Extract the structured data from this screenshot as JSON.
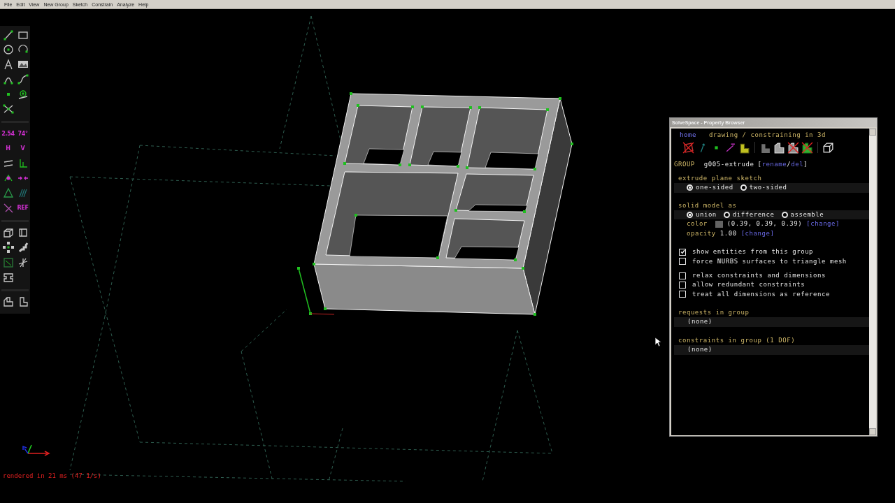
{
  "menu": [
    "File",
    "Edit",
    "View",
    "New Group",
    "Sketch",
    "Constrain",
    "Analyze",
    "Help"
  ],
  "toolbar": [
    [
      {
        "kind": "line"
      },
      {
        "kind": "rectangle"
      },
      {
        "kind": "circle"
      },
      {
        "kind": "arc"
      },
      {
        "kind": "text"
      },
      {
        "kind": "image"
      },
      {
        "kind": "tangent-arc"
      },
      {
        "kind": "spline"
      },
      {
        "kind": "point"
      },
      {
        "kind": "workplane"
      },
      {
        "kind": "split"
      }
    ],
    [
      {
        "kind": "distance",
        "label": "2.54"
      },
      {
        "kind": "angle",
        "label": "74°"
      },
      {
        "kind": "horizontal",
        "label": "H"
      },
      {
        "kind": "vertical",
        "label": "V"
      },
      {
        "kind": "parallel"
      },
      {
        "kind": "perpendicular"
      },
      {
        "kind": "on-point"
      },
      {
        "kind": "midpoint"
      },
      {
        "kind": "equal"
      },
      {
        "kind": "symmetric"
      },
      {
        "kind": "other"
      },
      {
        "kind": "reference",
        "label": "REF"
      }
    ],
    [
      {
        "kind": "extrude"
      },
      {
        "kind": "lathe"
      },
      {
        "kind": "rotate"
      },
      {
        "kind": "translate"
      },
      {
        "kind": "sketch-plane"
      },
      {
        "kind": "sketch-3d"
      },
      {
        "kind": "assemble"
      }
    ],
    [
      {
        "kind": "step-solid"
      },
      {
        "kind": "step-sketch"
      }
    ]
  ],
  "canvas": {
    "status": "rendered in 21 ms (47 1/s)"
  },
  "property_browser": {
    "title": "SolveSpace - Property Browser",
    "home": "home",
    "heading": "drawing / constraining in 3d",
    "icons": [
      {
        "kind": "workplane",
        "shown": false
      },
      {
        "kind": "normal",
        "shown": true
      },
      {
        "kind": "point",
        "shown": true
      },
      {
        "kind": "constraint",
        "shown": true
      },
      {
        "kind": "face",
        "shown": true
      },
      {
        "kind": "shaded",
        "shown": true
      },
      {
        "kind": "edges",
        "shown": true
      },
      {
        "kind": "outlines",
        "shown": false
      },
      {
        "kind": "mesh",
        "shown": false
      },
      {
        "kind": "perspective",
        "shown": true
      }
    ],
    "group": {
      "label": "GROUP",
      "name": "g005-extrude",
      "open": "[",
      "rename": "rename",
      "sep": "/",
      "del": "del",
      "close": "]"
    },
    "extrude": {
      "heading": "extrude plane sketch",
      "options": [
        {
          "label": "one-sided",
          "selected": true
        },
        {
          "label": "two-sided",
          "selected": false
        }
      ]
    },
    "solid": {
      "heading": "solid model as",
      "options": [
        {
          "label": "union",
          "selected": true
        },
        {
          "label": "difference",
          "selected": false
        },
        {
          "label": "assemble",
          "selected": false
        }
      ],
      "color": {
        "label": "color",
        "value": "(0.39, 0.39, 0.39)",
        "link": "[change]"
      },
      "opacity": {
        "label": "opacity",
        "value": "1.00",
        "link": "[change]"
      }
    },
    "checkbox_groups": [
      [
        {
          "label": "show entities from this group",
          "checked": true
        },
        {
          "label": "force NURBS surfaces to triangle mesh",
          "checked": false
        }
      ],
      [
        {
          "label": "relax constraints and dimensions",
          "checked": false
        },
        {
          "label": "allow redundant constraints",
          "checked": false
        },
        {
          "label": "treat all dimensions as reference",
          "checked": false
        }
      ]
    ],
    "lists": [
      {
        "heading": "requests in group",
        "items": [
          "(none)"
        ]
      },
      {
        "heading": "constraints in group (1 DOF)",
        "items": [
          "(none)"
        ]
      }
    ]
  }
}
